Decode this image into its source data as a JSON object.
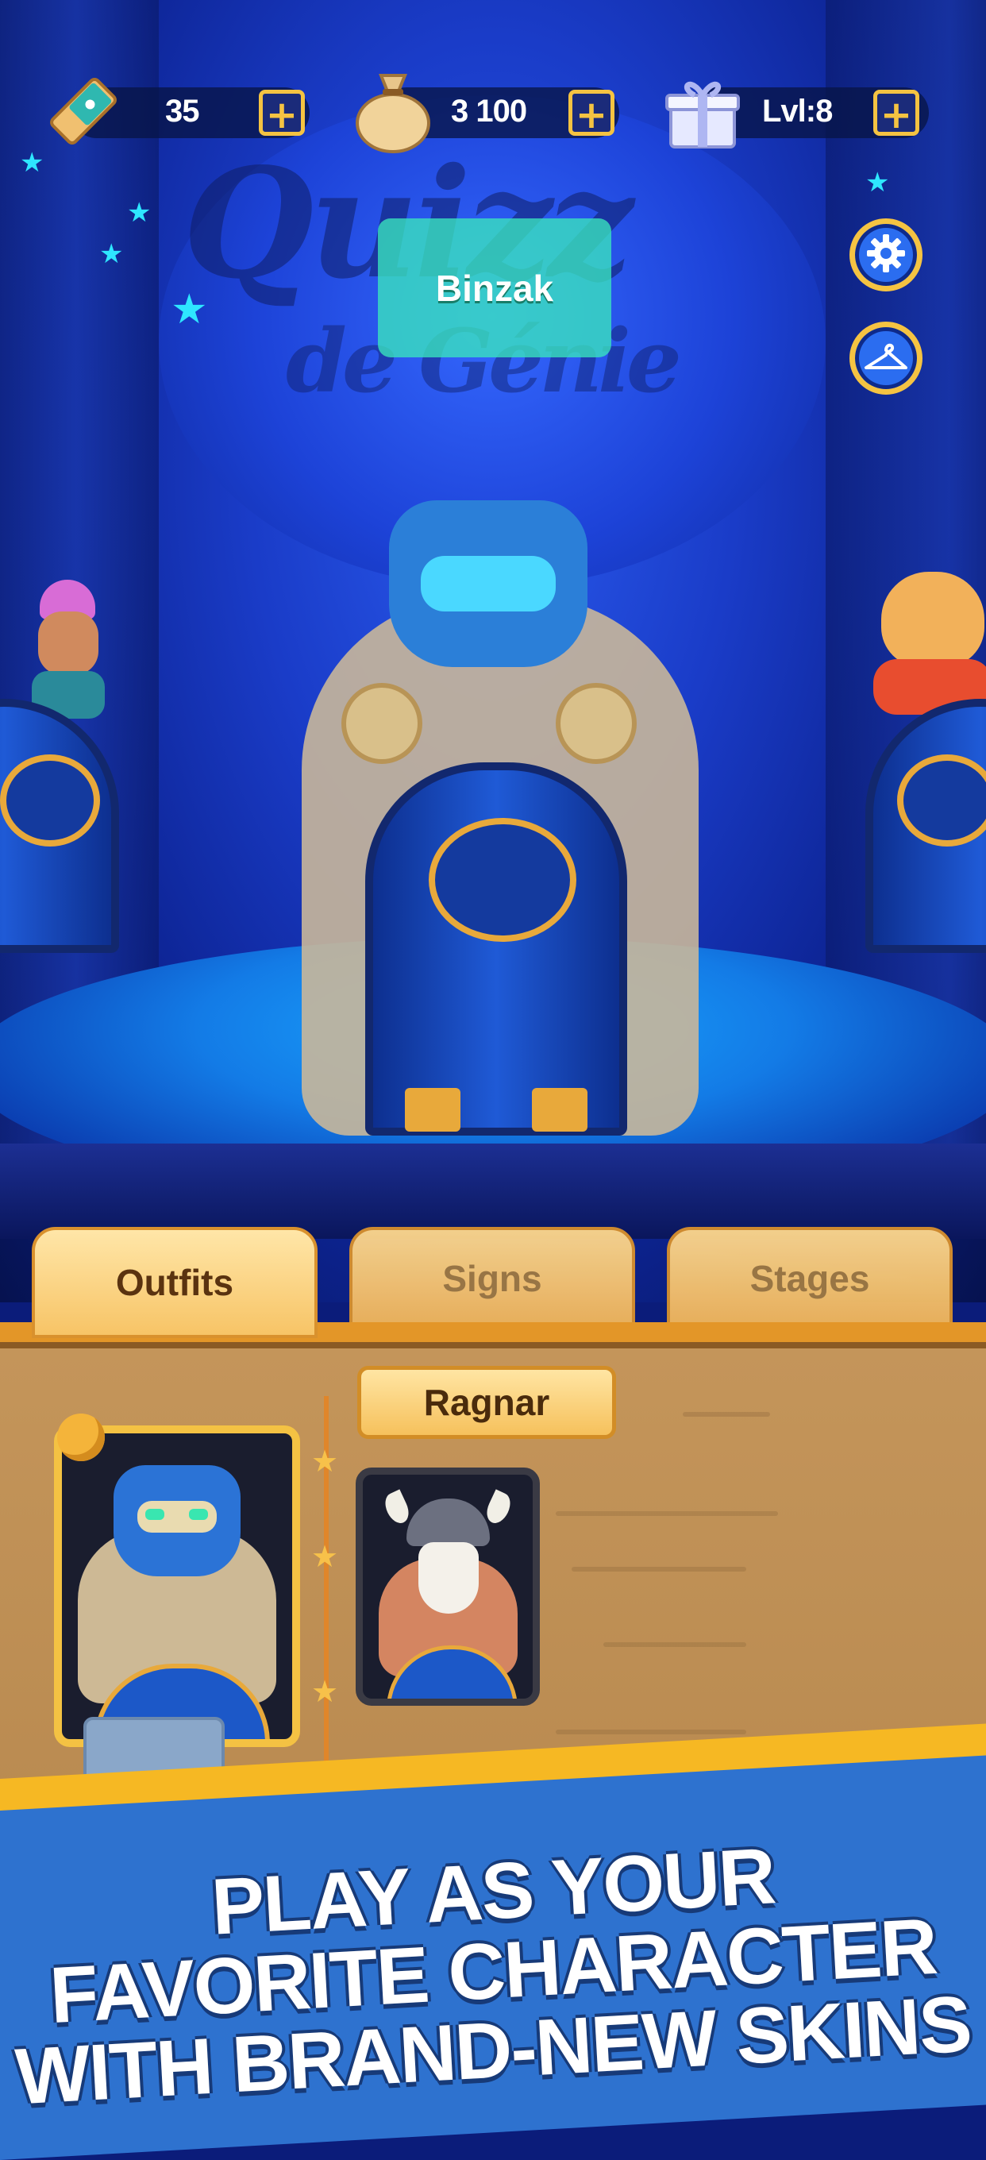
{
  "hud": {
    "tickets": {
      "icon": "ticket-icon",
      "value": "35"
    },
    "coins": {
      "icon": "money-bag-icon",
      "value": "3 100"
    },
    "level": {
      "icon": "gift-box-icon",
      "value": "Lvl:8"
    },
    "plus_label": "+"
  },
  "side_buttons": [
    {
      "icon": "gear-icon"
    },
    {
      "icon": "hanger-icon"
    }
  ],
  "scene": {
    "logo_line1": "Quizz",
    "logo_line2": "de Génie",
    "player_name": "Binzak"
  },
  "tabs": [
    {
      "label": "Outfits",
      "active": true
    },
    {
      "label": "Signs",
      "active": false
    },
    {
      "label": "Stages",
      "active": false
    }
  ],
  "outfits_panel": {
    "character_name": "Ragnar",
    "cards": [
      {
        "name": "robot-outfit",
        "selected": true
      },
      {
        "name": "viking-outfit",
        "selected": false
      }
    ]
  },
  "promo": {
    "line1": "PLAY AS YOUR",
    "line2": "FAVORITE CHARACTER",
    "line3": "WITH BRAND-NEW SKINS"
  },
  "colors": {
    "accent_gold": "#f5c342",
    "scene_blue": "#1a3cc8",
    "panel_parchment": "#c4955a",
    "banner_blue": "#2e72cf",
    "name_tag_teal": "#3ae6be"
  }
}
